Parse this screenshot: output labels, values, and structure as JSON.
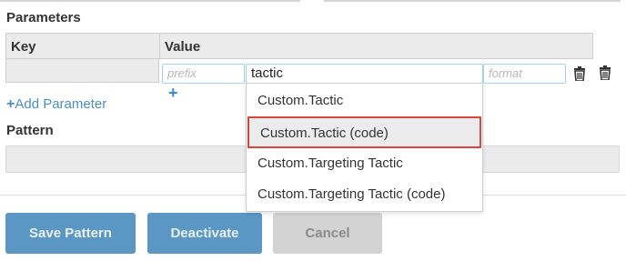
{
  "labels": {
    "parameters": "Parameters",
    "pattern": "Pattern"
  },
  "table": {
    "headers": {
      "key": "Key",
      "value": "Value"
    },
    "row": {
      "prefix_placeholder": "prefix",
      "value": "tactic",
      "format_placeholder": "format"
    }
  },
  "actions": {
    "add_parameter": "Add Parameter",
    "save": "Save Pattern",
    "deactivate": "Deactivate",
    "cancel": "Cancel"
  },
  "dropdown": {
    "items": [
      {
        "label": "Custom.Tactic"
      },
      {
        "label": "Custom.Tactic (code)",
        "highlighted": true
      },
      {
        "label": "Custom.Targeting Tactic"
      },
      {
        "label": "Custom.Targeting Tactic (code)"
      }
    ]
  },
  "colors": {
    "primary_button": "#5a97c4",
    "disabled_button": "#d3d3d3",
    "link": "#4a8fc7",
    "highlight_border": "#d9463c"
  },
  "icons": [
    "trash-icon",
    "plus-icon"
  ]
}
